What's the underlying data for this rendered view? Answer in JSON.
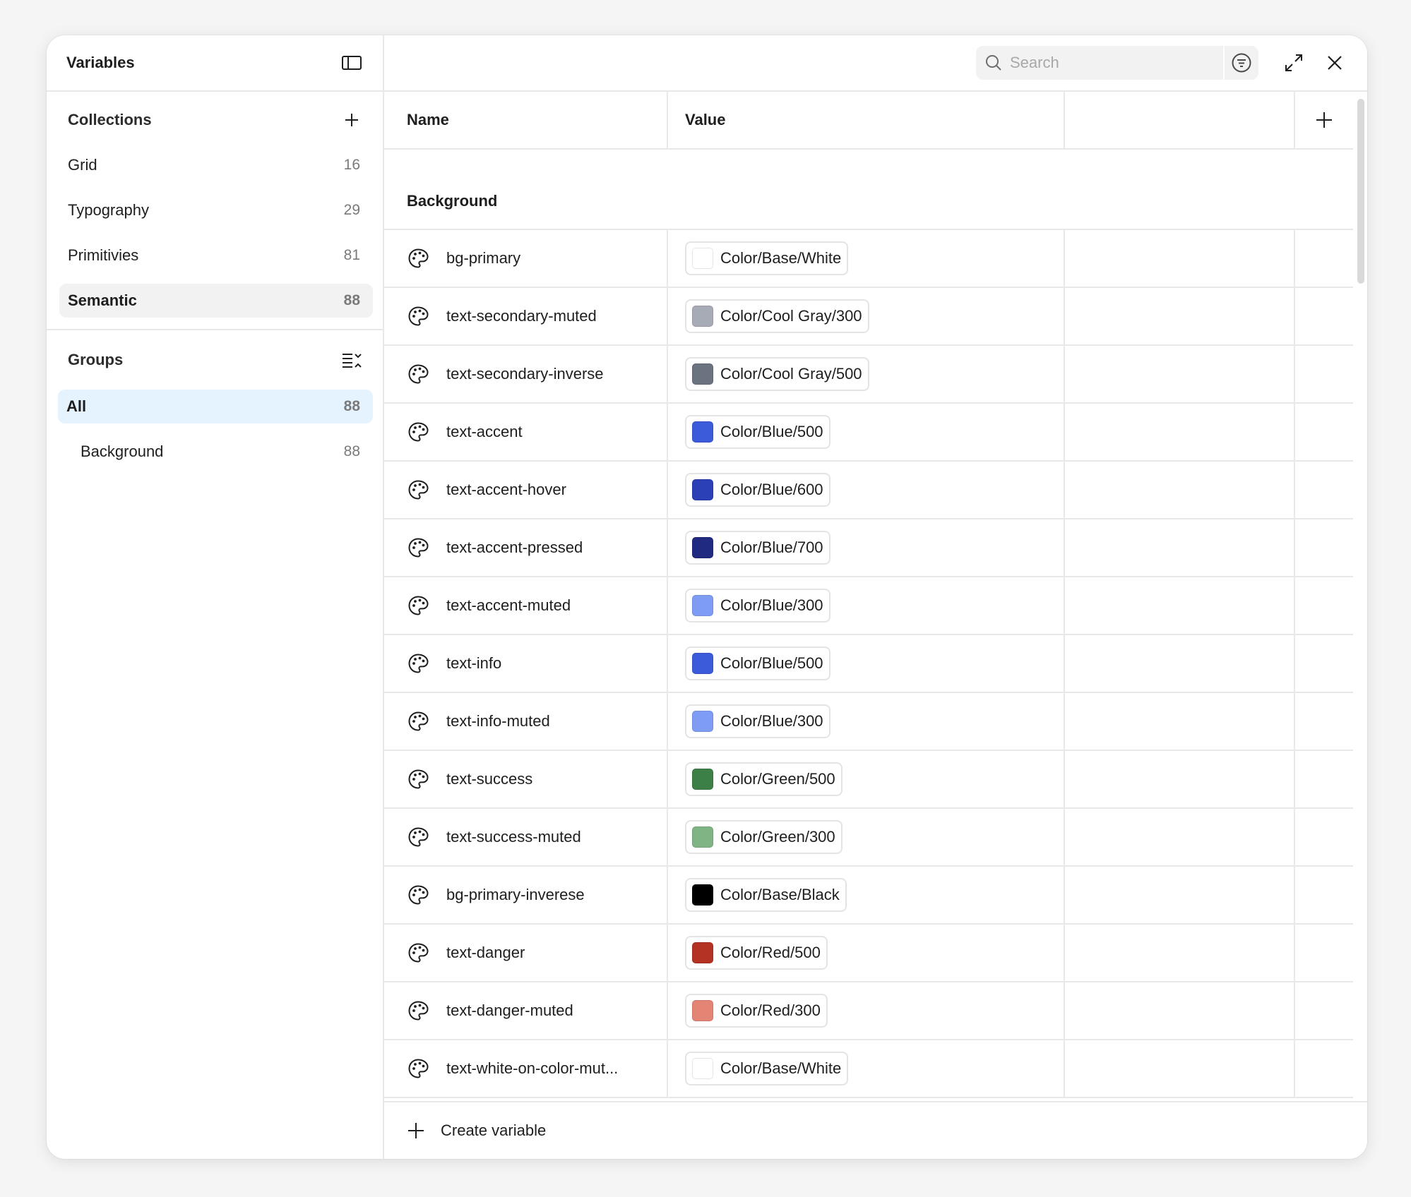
{
  "sidebar": {
    "title": "Variables",
    "collections_label": "Collections",
    "collections": [
      {
        "name": "Grid",
        "count": "16"
      },
      {
        "name": "Typography",
        "count": "29"
      },
      {
        "name": "Primitivies",
        "count": "81"
      },
      {
        "name": "Semantic",
        "count": "88"
      }
    ],
    "groups_label": "Groups",
    "groups": [
      {
        "name": "All",
        "count": "88"
      },
      {
        "name": "Background",
        "count": "88"
      }
    ]
  },
  "topbar": {
    "search_placeholder": "Search"
  },
  "table": {
    "col_name": "Name",
    "col_value": "Value",
    "group_title": "Background",
    "rows": [
      {
        "name": "bg-primary",
        "value": "Color/Base/White",
        "color": "#ffffff"
      },
      {
        "name": "text-secondary-muted",
        "value": "Color/Cool Gray/300",
        "color": "#a7abb6"
      },
      {
        "name": "text-secondary-inverse",
        "value": "Color/Cool Gray/500",
        "color": "#6b7280"
      },
      {
        "name": "text-accent",
        "value": "Color/Blue/500",
        "color": "#3b5bdb"
      },
      {
        "name": "text-accent-hover",
        "value": "Color/Blue/600",
        "color": "#2b3fb6"
      },
      {
        "name": "text-accent-pressed",
        "value": "Color/Blue/700",
        "color": "#1f2a80"
      },
      {
        "name": "text-accent-muted",
        "value": "Color/Blue/300",
        "color": "#7f9cf5"
      },
      {
        "name": "text-info",
        "value": "Color/Blue/500",
        "color": "#3b5bdb"
      },
      {
        "name": "text-info-muted",
        "value": "Color/Blue/300",
        "color": "#7f9cf5"
      },
      {
        "name": "text-success",
        "value": "Color/Green/500",
        "color": "#3c8048"
      },
      {
        "name": "text-success-muted",
        "value": "Color/Green/300",
        "color": "#7fb585"
      },
      {
        "name": "bg-primary-inverese",
        "value": "Color/Base/Black",
        "color": "#000000"
      },
      {
        "name": "text-danger",
        "value": "Color/Red/500",
        "color": "#b33224"
      },
      {
        "name": "text-danger-muted",
        "value": "Color/Red/300",
        "color": "#e38474"
      },
      {
        "name": "text-white-on-color-mut...",
        "value": "Color/Base/White",
        "color": "#ffffff"
      }
    ]
  },
  "footer": {
    "create_label": "Create variable"
  }
}
